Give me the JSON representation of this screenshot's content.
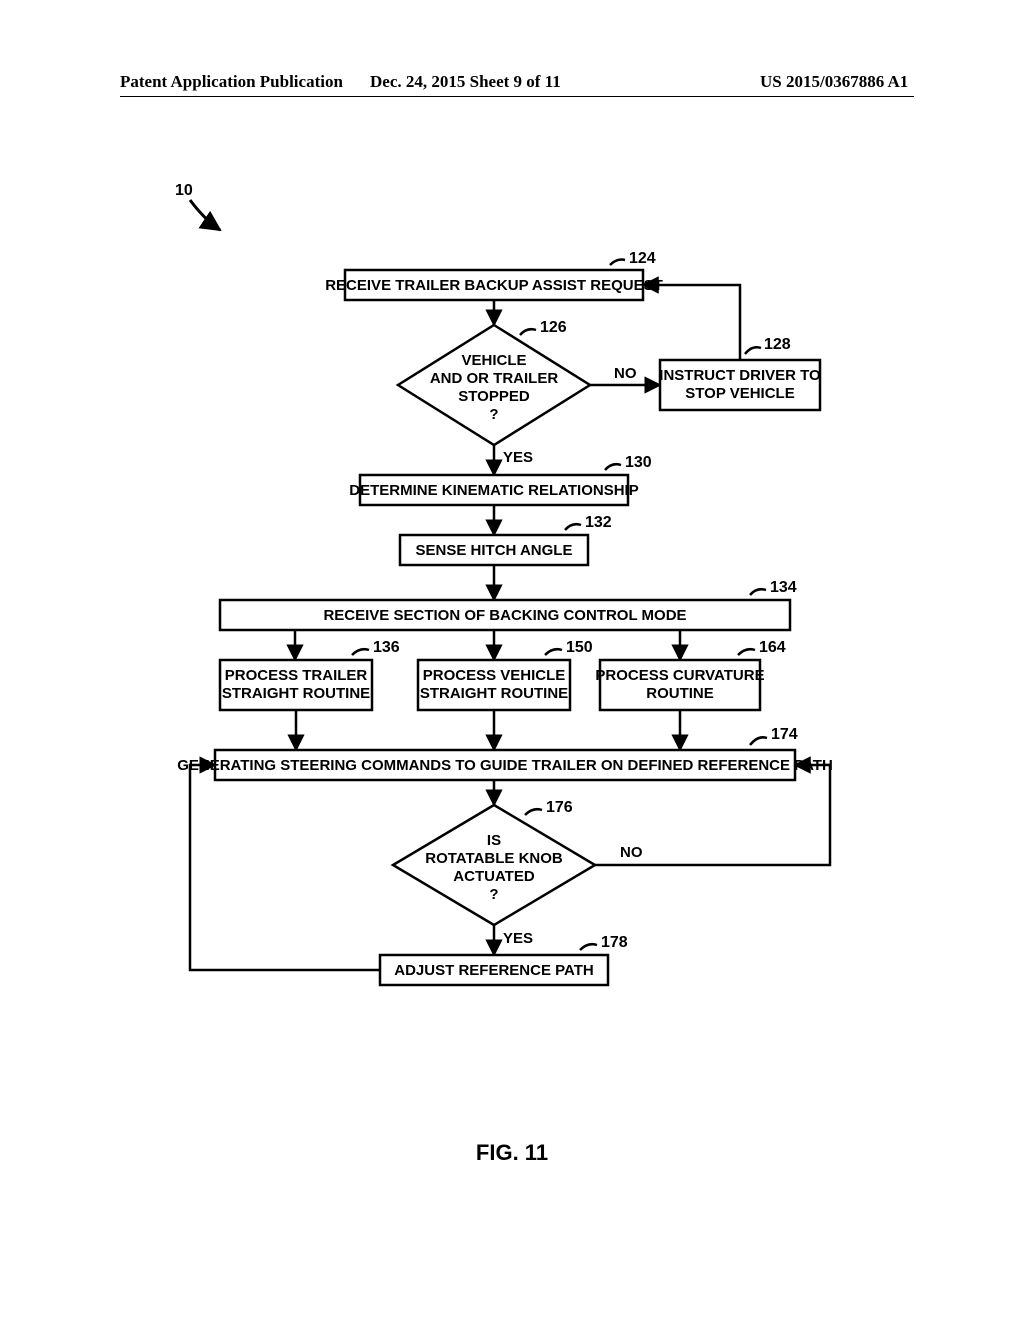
{
  "header": {
    "left": "Patent Application Publication",
    "center": "Dec. 24, 2015  Sheet 9 of 11",
    "right": "US 2015/0367886 A1"
  },
  "flow": {
    "ref_top": "10",
    "box124": "RECEIVE TRAILER BACKUP ASSIST REQUEST",
    "lbl124": "124",
    "dec126_l1": "VEHICLE",
    "dec126_l2": "AND OR TRAILER",
    "dec126_l3": "STOPPED",
    "dec126_l4": "?",
    "lbl126": "126",
    "dec126_no": "NO",
    "dec126_yes": "YES",
    "box128_l1": "INSTRUCT DRIVER TO",
    "box128_l2": "STOP VEHICLE",
    "lbl128": "128",
    "box130": "DETERMINE KINEMATIC RELATIONSHIP",
    "lbl130": "130",
    "box132": "SENSE HITCH ANGLE",
    "lbl132": "132",
    "box134": "RECEIVE SECTION OF BACKING CONTROL MODE",
    "lbl134": "134",
    "box136_l1": "PROCESS TRAILER",
    "box136_l2": "STRAIGHT ROUTINE",
    "lbl136": "136",
    "box150_l1": "PROCESS VEHICLE",
    "box150_l2": "STRAIGHT ROUTINE",
    "lbl150": "150",
    "box164_l1": "PROCESS CURVATURE",
    "box164_l2": "ROUTINE",
    "lbl164": "164",
    "box174": "GENERATING STEERING COMMANDS TO GUIDE TRAILER ON DEFINED REFERENCE PATH",
    "lbl174": "174",
    "dec176_l1": "IS",
    "dec176_l2": "ROTATABLE KNOB",
    "dec176_l3": "ACTUATED",
    "dec176_l4": "?",
    "dec176_no": "NO",
    "dec176_yes": "YES",
    "lbl176": "176",
    "box178": "ADJUST REFERENCE PATH",
    "lbl178": "178"
  },
  "caption": "FIG. 11",
  "chart_data": {
    "type": "flowchart",
    "title": "FIG. 11",
    "reference_numeral": 10,
    "nodes": [
      {
        "id": 124,
        "shape": "process",
        "text": "RECEIVE TRAILER BACKUP ASSIST REQUEST"
      },
      {
        "id": 126,
        "shape": "decision",
        "text": "VEHICLE AND OR TRAILER STOPPED ?"
      },
      {
        "id": 128,
        "shape": "process",
        "text": "INSTRUCT DRIVER TO STOP VEHICLE"
      },
      {
        "id": 130,
        "shape": "process",
        "text": "DETERMINE KINEMATIC RELATIONSHIP"
      },
      {
        "id": 132,
        "shape": "process",
        "text": "SENSE HITCH ANGLE"
      },
      {
        "id": 134,
        "shape": "process",
        "text": "RECEIVE SECTION OF BACKING CONTROL MODE"
      },
      {
        "id": 136,
        "shape": "process",
        "text": "PROCESS TRAILER STRAIGHT ROUTINE"
      },
      {
        "id": 150,
        "shape": "process",
        "text": "PROCESS VEHICLE STRAIGHT ROUTINE"
      },
      {
        "id": 164,
        "shape": "process",
        "text": "PROCESS CURVATURE ROUTINE"
      },
      {
        "id": 174,
        "shape": "process",
        "text": "GENERATING STEERING COMMANDS TO GUIDE TRAILER ON DEFINED REFERENCE PATH"
      },
      {
        "id": 176,
        "shape": "decision",
        "text": "IS ROTATABLE KNOB ACTUATED ?"
      },
      {
        "id": 178,
        "shape": "process",
        "text": "ADJUST REFERENCE PATH"
      }
    ],
    "edges": [
      {
        "from": 124,
        "to": 126
      },
      {
        "from": 126,
        "to": 128,
        "label": "NO"
      },
      {
        "from": 128,
        "to": 124
      },
      {
        "from": 126,
        "to": 130,
        "label": "YES"
      },
      {
        "from": 130,
        "to": 132
      },
      {
        "from": 132,
        "to": 134
      },
      {
        "from": 134,
        "to": 136
      },
      {
        "from": 134,
        "to": 150
      },
      {
        "from": 134,
        "to": 164
      },
      {
        "from": 136,
        "to": 174
      },
      {
        "from": 150,
        "to": 174
      },
      {
        "from": 164,
        "to": 174
      },
      {
        "from": 174,
        "to": 176
      },
      {
        "from": 176,
        "to": 174,
        "label": "NO"
      },
      {
        "from": 176,
        "to": 178,
        "label": "YES"
      },
      {
        "from": 178,
        "to": 174
      }
    ]
  }
}
